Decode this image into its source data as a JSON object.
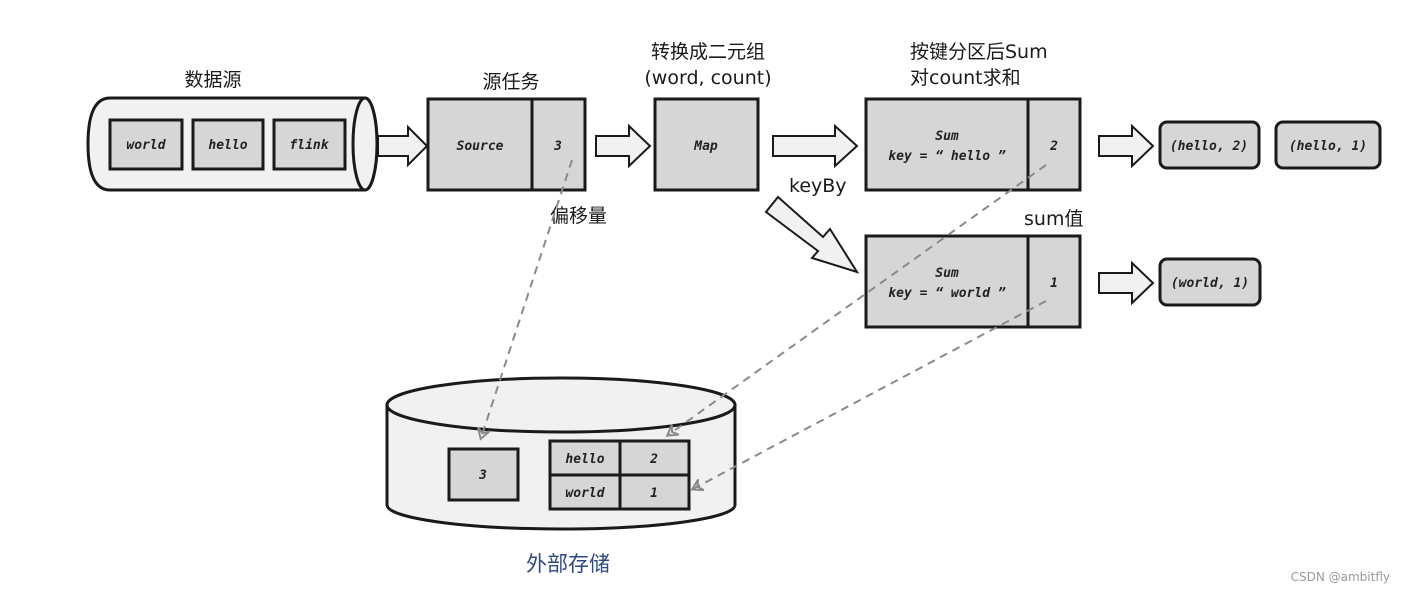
{
  "labels": {
    "data_source": "数据源",
    "source_task": "源任务",
    "map_title_line1": "转换成二元组",
    "map_title_line2": "(word, count)",
    "sum_title_line1": "按键分区后Sum",
    "sum_title_line2": "对count求和",
    "offset": "偏移量",
    "keyby": "keyBy",
    "sum_value": "sum值",
    "external_storage": "外部存储"
  },
  "data_source_items": [
    "world",
    "hello",
    "flink"
  ],
  "source_task": {
    "name": "Source",
    "offset": "3"
  },
  "map_task": {
    "name": "Map"
  },
  "sum_tasks": [
    {
      "name": "Sum",
      "key_line": "key = “ hello ”",
      "value": "2",
      "outputs": [
        "(hello, 2)",
        "(hello, 1)"
      ]
    },
    {
      "name": "Sum",
      "key_line": "key = “ world ”",
      "value": "1",
      "outputs": [
        "(world, 1)"
      ]
    }
  ],
  "storage": {
    "offset": "3",
    "table": [
      {
        "key": "hello",
        "value": "2"
      },
      {
        "key": "world",
        "value": "1"
      }
    ]
  },
  "watermark": "CSDN @ambitfly"
}
